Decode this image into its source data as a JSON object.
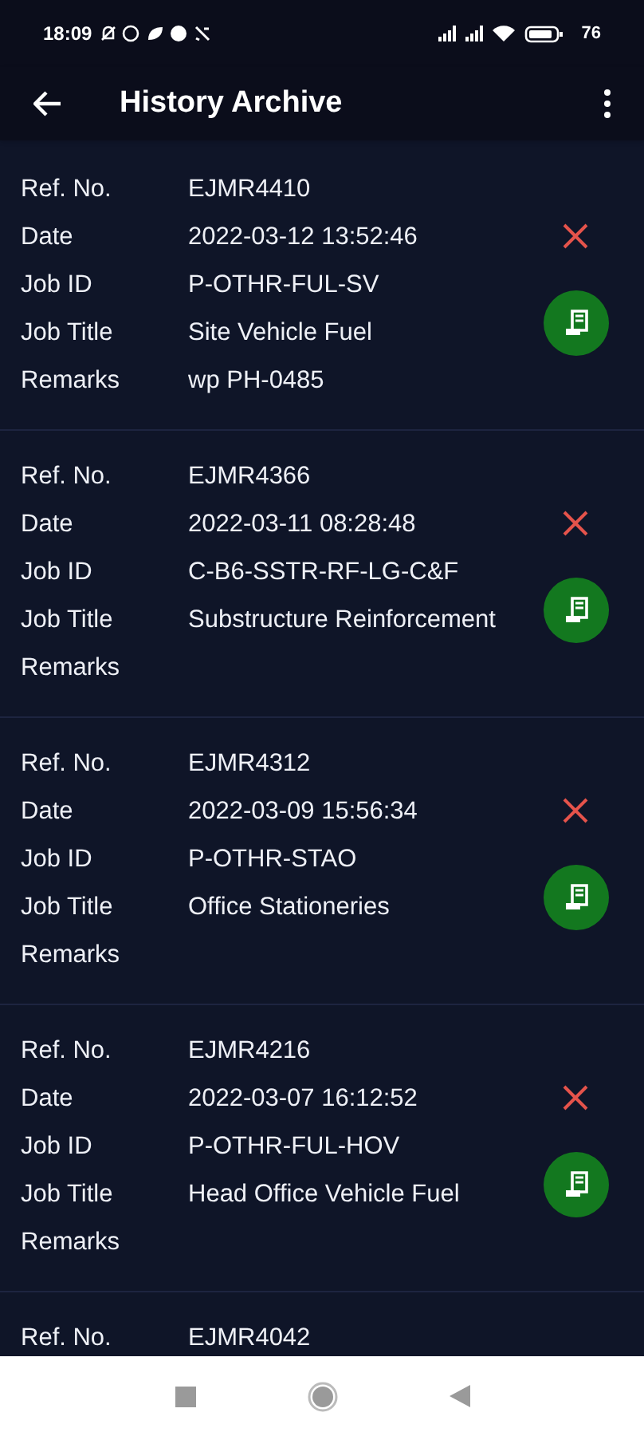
{
  "status_bar": {
    "time": "18:09",
    "battery": "76"
  },
  "app_bar": {
    "title": "History Archive"
  },
  "records": [
    {
      "fields": [
        {
          "label": "Ref. No.",
          "value": "EJMR4410"
        },
        {
          "label": "Date",
          "value": "2022-03-12 13:52:46"
        },
        {
          "label": "Job ID",
          "value": "P-OTHR-FUL-SV"
        },
        {
          "label": "Job Title",
          "value": "Site Vehicle Fuel"
        },
        {
          "label": "Remarks",
          "value": "wp PH-0485"
        }
      ],
      "actions": true
    },
    {
      "fields": [
        {
          "label": "Ref. No.",
          "value": "EJMR4366"
        },
        {
          "label": "Date",
          "value": "2022-03-11 08:28:48"
        },
        {
          "label": "Job ID",
          "value": "C-B6-SSTR-RF-LG-C&F"
        },
        {
          "label": "Job Title",
          "value": "Substructure Reinforcement"
        },
        {
          "label": "Remarks"
        }
      ],
      "actions": true
    },
    {
      "fields": [
        {
          "label": "Ref. No.",
          "value": "EJMR4312"
        },
        {
          "label": "Date",
          "value": "2022-03-09 15:56:34"
        },
        {
          "label": "Job ID",
          "value": "P-OTHR-STAO"
        },
        {
          "label": "Job Title",
          "value": "Office Stationeries"
        },
        {
          "label": "Remarks"
        }
      ],
      "actions": true
    },
    {
      "fields": [
        {
          "label": "Ref. No.",
          "value": "EJMR4216"
        },
        {
          "label": "Date",
          "value": "2022-03-07 16:12:52"
        },
        {
          "label": "Job ID",
          "value": "P-OTHR-FUL-HOV"
        },
        {
          "label": "Job Title",
          "value": "Head Office Vehicle Fuel"
        },
        {
          "label": "Remarks"
        }
      ],
      "actions": true
    },
    {
      "fields": [
        {
          "label": "Ref. No.",
          "value": "EJMR4042"
        }
      ],
      "actions": false
    }
  ]
}
